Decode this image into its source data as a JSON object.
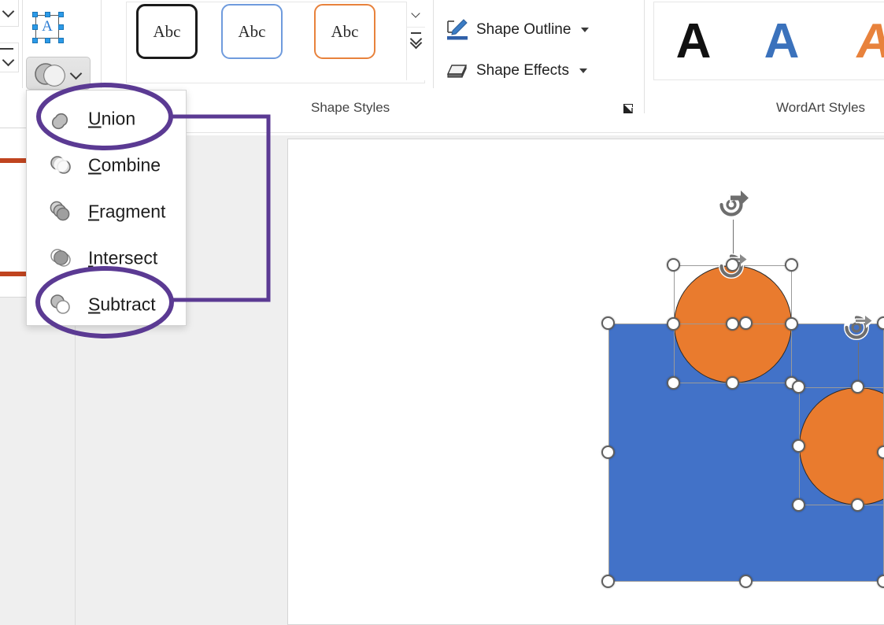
{
  "app": "PowerPoint Shape Format ribbon with Merge Shapes menu open",
  "colors": {
    "accent_purple": "#5B3A93",
    "shape_blue": "#4272C8",
    "shape_orange": "#E97B2E",
    "thumb_red": "#C0441F",
    "wordart_blue": "#3B72BC",
    "wordart_orange": "#E8823C",
    "workspace_gray": "#EFEFEF"
  },
  "ribbon": {
    "shape_styles": {
      "group_label": "Shape Styles",
      "dialog_launcher_name": "shape-styles-dialog-launcher",
      "gallery": [
        {
          "label": "Abc",
          "outline": "#1b1b1b"
        },
        {
          "label": "Abc",
          "outline": "#6f9bdd"
        },
        {
          "label": "Abc",
          "outline": "#e8823c"
        }
      ],
      "scroll_up": "scroll-up-icon",
      "scroll_down": "scroll-down-icon",
      "more_styles": "more-styles-icon"
    },
    "shape_commands": [
      {
        "label": "Shape Outline",
        "icon": "pen-outline-icon",
        "has_caret": true
      },
      {
        "label": "Shape Effects",
        "icon": "shape-effects-icon",
        "has_caret": true
      }
    ],
    "wordart_styles": {
      "group_label": "WordArt Styles",
      "gallery": [
        {
          "label": "A",
          "color": "#111111"
        },
        {
          "label": "A",
          "color": "#3B72BC"
        },
        {
          "label": "A",
          "color": "#E8823C"
        }
      ]
    },
    "text_box_icon": {
      "name": "text-box-icon",
      "glyph": "A"
    },
    "merge_shapes_button": {
      "name": "merge-shapes-button",
      "state": "pressed"
    },
    "left_mini_buttons": [
      {
        "name": "arrange-dropdown-top",
        "icon": "chevron-down-icon"
      },
      {
        "name": "arrange-dropdown-bottom",
        "icon": "chevron-down-icon"
      }
    ]
  },
  "merge_menu": {
    "name": "merge-shapes-menu",
    "items": [
      {
        "label": "Union",
        "accel": "U",
        "rest": "nion",
        "icon": "union-icon"
      },
      {
        "label": "Combine",
        "accel": "C",
        "rest": "ombine",
        "icon": "combine-icon"
      },
      {
        "label": "Fragment",
        "accel": "F",
        "rest": "ragment",
        "icon": "fragment-icon"
      },
      {
        "label": "Intersect",
        "accel": "I",
        "rest": "ntersect",
        "icon": "intersect-icon"
      },
      {
        "label": "Subtract",
        "accel": "S",
        "rest": "ubtract",
        "icon": "subtract-icon"
      }
    ]
  },
  "annotations": {
    "ellipse_union": {
      "name": "annotation-ellipse-union",
      "targets": "Union"
    },
    "ellipse_subtract": {
      "name": "annotation-ellipse-subtract",
      "targets": "Subtract"
    },
    "bracket_connector": {
      "name": "annotation-bracket-connector",
      "connects": "Union to Subtract"
    }
  },
  "thumbnail_pane": {
    "name": "slide-thumbnail-pane",
    "slide": {
      "name": "slide-thumbnail-1",
      "bars": 2
    }
  },
  "canvas": {
    "name": "slide-canvas",
    "shapes": [
      {
        "name": "shape-rectangle-blue",
        "type": "rectangle",
        "fill": "#4272C8",
        "selected": true
      },
      {
        "name": "shape-circle-orange-top",
        "type": "circle",
        "fill": "#E97B2E",
        "selected": true
      },
      {
        "name": "shape-circle-orange-right",
        "type": "circle",
        "fill": "#E97B2E",
        "selected": true
      }
    ],
    "selection_handle_name": "selection-handle",
    "rotation_handle_name": "rotation-handle"
  }
}
